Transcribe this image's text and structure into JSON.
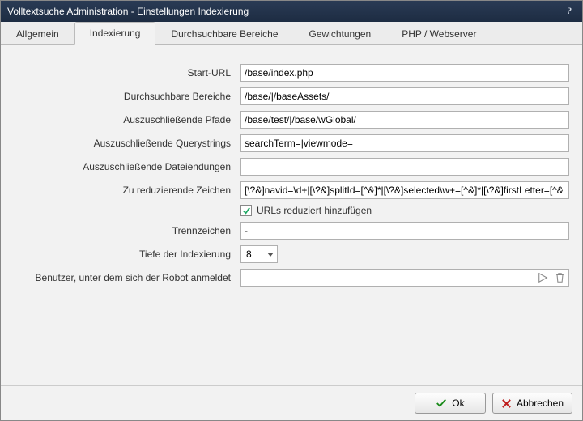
{
  "titlebar": {
    "title": "Volltextsuche Administration - Einstellungen Indexierung"
  },
  "tabs": {
    "items": [
      {
        "label": "Allgemein"
      },
      {
        "label": "Indexierung"
      },
      {
        "label": "Durchsuchbare Bereiche"
      },
      {
        "label": "Gewichtungen"
      },
      {
        "label": "PHP / Webserver"
      }
    ],
    "active_index": 1
  },
  "form": {
    "start_url": {
      "label": "Start-URL",
      "value": "/base/index.php"
    },
    "search_areas": {
      "label": "Durchsuchbare Bereiche",
      "value": "/base/|/baseAssets/"
    },
    "exclude_paths": {
      "label": "Auszuschließende Pfade",
      "value": "/base/test/|/base/wGlobal/"
    },
    "exclude_query": {
      "label": "Auszuschließende Querystrings",
      "value": "searchTerm=|viewmode="
    },
    "exclude_ext": {
      "label": "Auszuschließende Dateiendungen",
      "value": ""
    },
    "reduce_chars": {
      "label": "Zu reduzierende Zeichen",
      "value": "[\\?&]navid=\\d+|[\\?&]splitId=[^&]*|[\\?&]selected\\w+=[^&]*|[\\?&]firstLetter=[^&"
    },
    "reduced_checkbox": {
      "label": "URLs reduziert hinzufügen",
      "checked": true
    },
    "separator": {
      "label": "Trennzeichen",
      "value": "-"
    },
    "depth": {
      "label": "Tiefe der Indexierung",
      "value": "8"
    },
    "robot_user": {
      "label": "Benutzer, unter dem sich der Robot anmeldet",
      "value": ""
    }
  },
  "footer": {
    "ok": "Ok",
    "cancel": "Abbrechen"
  }
}
